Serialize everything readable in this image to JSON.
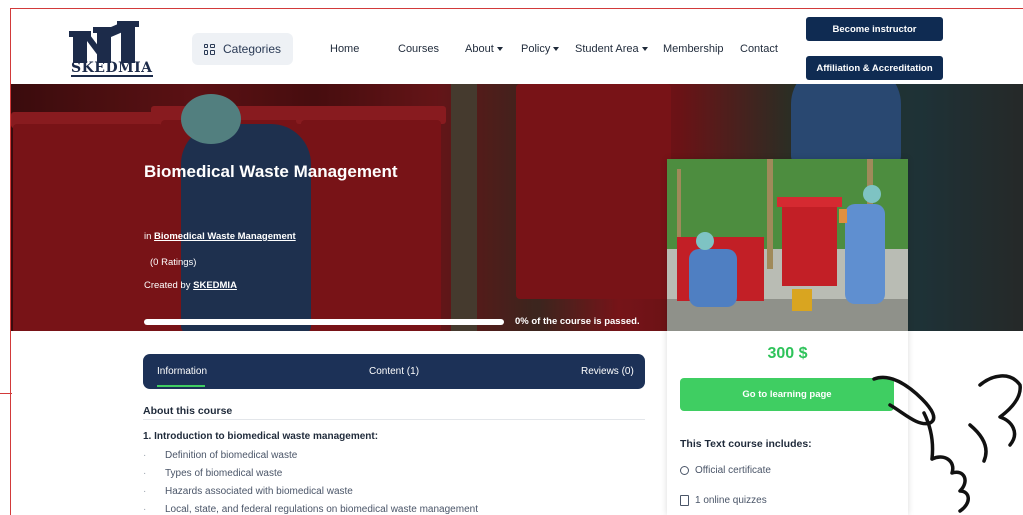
{
  "brand": {
    "name": "SKEDMIA"
  },
  "header": {
    "categories_label": "Categories",
    "nav": [
      {
        "label": "Home",
        "dropdown": false
      },
      {
        "label": "Courses",
        "dropdown": false
      },
      {
        "label": "About",
        "dropdown": true
      },
      {
        "label": "Policy",
        "dropdown": true
      },
      {
        "label": "Student Area",
        "dropdown": true
      },
      {
        "label": "Membership",
        "dropdown": false
      },
      {
        "label": "Contact",
        "dropdown": false
      }
    ],
    "become_instructor": "Become instructor",
    "affiliation": "Affiliation & Accreditation"
  },
  "hero": {
    "title": "Biomedical Waste Management",
    "in_prefix": "in",
    "category_link": "Biomedical Waste Management",
    "ratings": "(0 Ratings)",
    "created_prefix": "Created by",
    "creator": "SKEDMIA",
    "progress_percent": 0,
    "progress_label": "0% of the course is passed."
  },
  "card": {
    "price": "300 $",
    "learn_button": "Go to learning page",
    "includes_title": "This Text course includes:",
    "includes": [
      {
        "icon": "certificate-icon",
        "label": "Official certificate"
      },
      {
        "icon": "document-icon",
        "label": "1 online quizzes"
      }
    ]
  },
  "tabs": {
    "information": "Information",
    "content": "Content (1)",
    "reviews": "Reviews (0)"
  },
  "about": {
    "title": "About this course",
    "section_heading": "1.   Introduction to biomedical waste management:",
    "items": [
      "Definition of biomedical waste",
      "Types of biomedical waste",
      "Hazards associated with biomedical waste",
      "Local, state, and federal regulations on biomedical waste management"
    ]
  },
  "colors": {
    "navy": "#0f2b52",
    "tab_bar": "#1c3157",
    "green": "#3fce62",
    "frame_red": "#d23a3a"
  }
}
